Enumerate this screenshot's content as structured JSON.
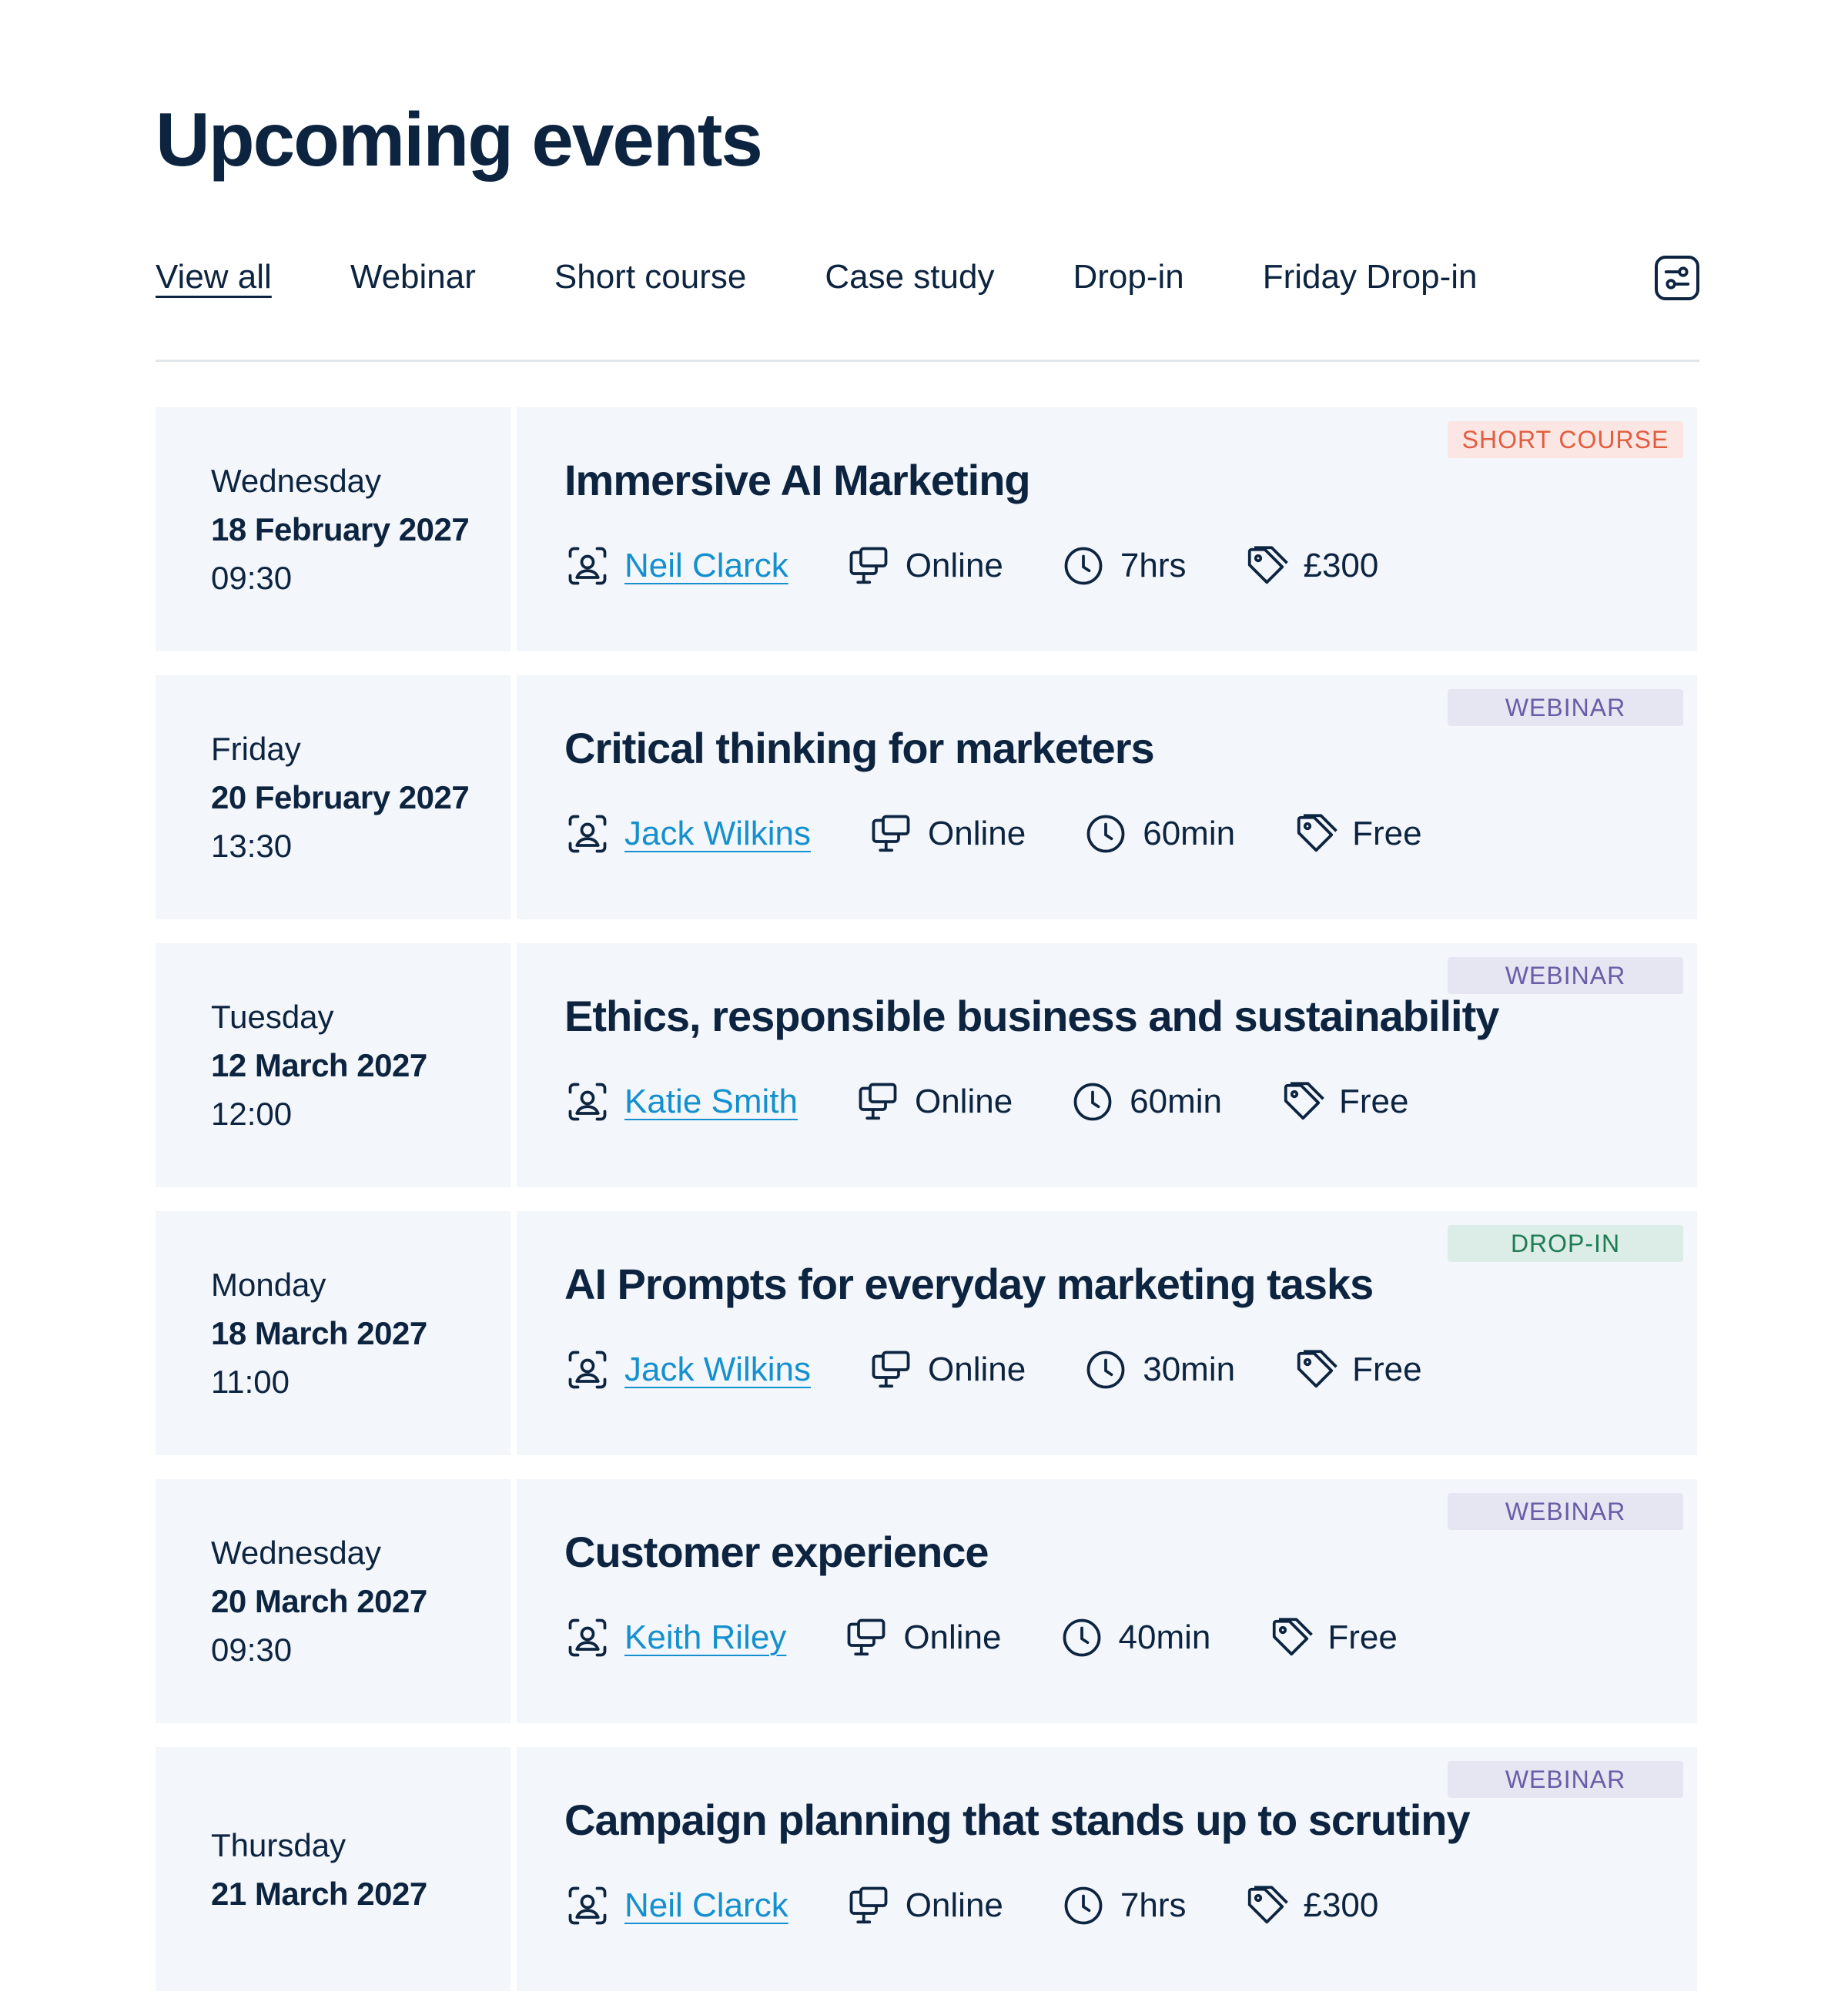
{
  "page": {
    "title": "Upcoming events"
  },
  "tabs": [
    "View all",
    "Webinar",
    "Short course",
    "Case study",
    "Drop-in",
    "Friday Drop-in"
  ],
  "active_tab": "View all",
  "events": [
    {
      "day": "Wednesday",
      "date": "18 February 2027",
      "time": "09:30",
      "badge": "SHORT COURSE",
      "badge_type": "short",
      "title": "Immersive AI Marketing",
      "presenter": "Neil Clarck",
      "location": "Online",
      "duration": "7hrs",
      "price": "£300"
    },
    {
      "day": "Friday",
      "date": "20 February 2027",
      "time": "13:30",
      "badge": "WEBINAR",
      "badge_type": "webinar",
      "title": "Critical thinking for marketers",
      "presenter": "Jack Wilkins",
      "location": "Online",
      "duration": "60min",
      "price": "Free"
    },
    {
      "day": "Tuesday",
      "date": "12 March 2027",
      "time": "12:00",
      "badge": "WEBINAR",
      "badge_type": "webinar",
      "title": "Ethics, responsible business and sustainability",
      "presenter": "Katie Smith",
      "location": "Online",
      "duration": "60min",
      "price": "Free"
    },
    {
      "day": "Monday",
      "date": "18 March 2027",
      "time": "11:00",
      "badge": "DROP-IN",
      "badge_type": "dropin",
      "title": "AI Prompts for everyday marketing tasks",
      "presenter": "Jack Wilkins",
      "location": "Online",
      "duration": "30min",
      "price": "Free"
    },
    {
      "day": "Wednesday",
      "date": "20 March 2027",
      "time": "09:30",
      "badge": "WEBINAR",
      "badge_type": "webinar",
      "title": "Customer experience",
      "presenter": "Keith Riley",
      "location": "Online",
      "duration": "40min",
      "price": "Free"
    },
    {
      "day": "Thursday",
      "date": "21 March 2027",
      "time": "",
      "badge": "WEBINAR",
      "badge_type": "webinar",
      "title": "Campaign planning that stands up to scrutiny",
      "presenter": "Neil Clarck",
      "location": "Online",
      "duration": "7hrs",
      "price": "£300"
    }
  ],
  "icons": {
    "filter": "sliders-icon",
    "presenter": "person-icon",
    "location": "monitor-icon",
    "duration": "clock-icon",
    "price": "price-tag-icon"
  },
  "colors": {
    "text": "#0d2440",
    "link": "#1590cf",
    "card_bg": "#f3f6fa",
    "short_course": "#e25d40",
    "webinar": "#6a5ca8",
    "drop_in": "#1c7d55"
  }
}
